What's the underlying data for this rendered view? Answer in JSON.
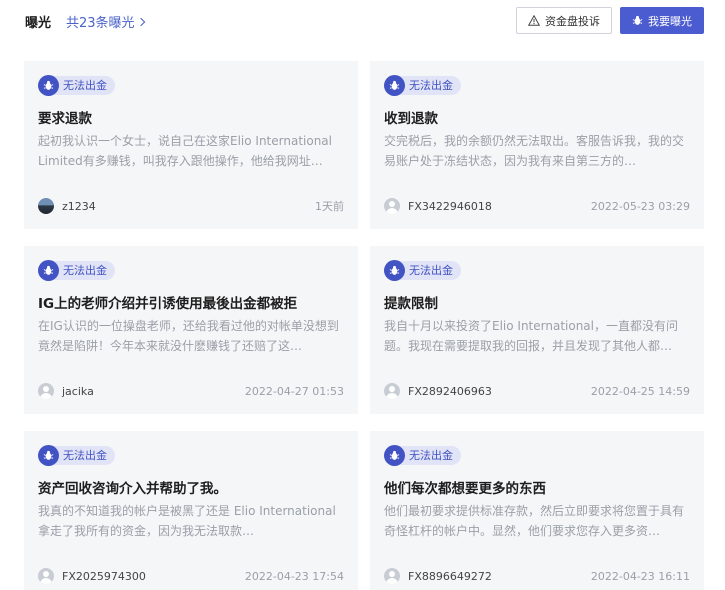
{
  "header": {
    "title": "曝光",
    "count_link": "共23条曝光",
    "complaint_button": "资金盘投诉",
    "expose_button": "我要曝光"
  },
  "cards": [
    {
      "tag": "无法出金",
      "title": "要求退款",
      "description": "起初我认识一个女士，说自己在这家Elio International Limited有多赚钱，叫我存入跟他操作，他给我网址…",
      "user": "z1234",
      "time": "1天前"
    },
    {
      "tag": "无法出金",
      "title": "收到退款",
      "description": "交完税后，我的余额仍然无法取出。客服告诉我，我的交易账户处于冻结状态，因为我有来自第三方的…",
      "user": "FX3422946018",
      "time": "2022-05-23 03:29"
    },
    {
      "tag": "无法出金",
      "title": "IG上的老师介绍并引诱使用最後出金都被拒",
      "description": "在IG认识的一位操盘老师，还给我看过他的对帐单没想到竟然是陷阱！今年本来就没什麽赚钱了还赔了这…",
      "user": "jacika",
      "time": "2022-04-27 01:53"
    },
    {
      "tag": "无法出金",
      "title": "提款限制",
      "description": "我自十月以来投资了Elio International，一直都没有问题。我现在需要提取我的回报，并且发现了其他人都…",
      "user": "FX2892406963",
      "time": "2022-04-25 14:59"
    },
    {
      "tag": "无法出金",
      "title": "资产回收咨询介入并帮助了我。",
      "description": "我真的不知道我的帐户是被黑了还是 Elio International拿走了我所有的资金，因为我无法取款…",
      "user": "FX2025974300",
      "time": "2022-04-23 17:54"
    },
    {
      "tag": "无法出金",
      "title": "他们每次都想要更多的东西",
      "description": "他们最初要求提供标准存款，然后立即要求将您置于具有奇怪杠杆的帐户中。显然，他们要求您存入更多资…",
      "user": "FX8896649272",
      "time": "2022-04-23 16:11"
    }
  ],
  "colors": {
    "accent": "#4b5bd0",
    "badge_bg": "#e1e4f6",
    "card_bg": "#f5f6f8",
    "muted_text": "#9a9fa8"
  },
  "icons": {
    "count_link": "chevron-right-icon",
    "complaint_button": "warning-icon",
    "expose_button": "bug-icon",
    "badge": "bug-icon",
    "avatar": "user-avatar-icon"
  }
}
